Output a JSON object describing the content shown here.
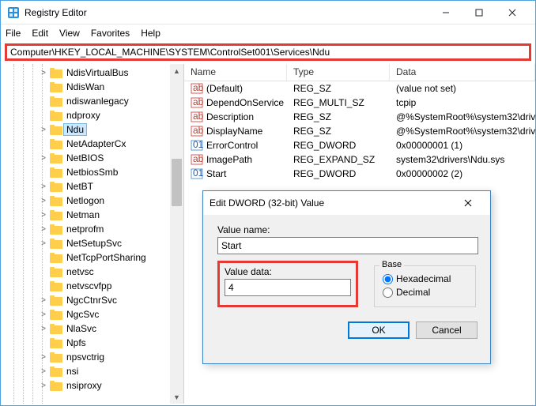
{
  "window": {
    "title": "Registry Editor"
  },
  "menu": {
    "file": "File",
    "edit": "Edit",
    "view": "View",
    "favorites": "Favorites",
    "help": "Help"
  },
  "address": {
    "value": "Computer\\HKEY_LOCAL_MACHINE\\SYSTEM\\ControlSet001\\Services\\Ndu"
  },
  "tree": {
    "items": [
      {
        "label": "NdisVirtualBus",
        "tw": ">"
      },
      {
        "label": "NdisWan",
        "tw": ""
      },
      {
        "label": "ndiswanlegacy",
        "tw": ""
      },
      {
        "label": "ndproxy",
        "tw": ""
      },
      {
        "label": "Ndu",
        "tw": ">",
        "selected": true
      },
      {
        "label": "NetAdapterCx",
        "tw": ""
      },
      {
        "label": "NetBIOS",
        "tw": ">"
      },
      {
        "label": "NetbiosSmb",
        "tw": ""
      },
      {
        "label": "NetBT",
        "tw": ">"
      },
      {
        "label": "Netlogon",
        "tw": ">"
      },
      {
        "label": "Netman",
        "tw": ">"
      },
      {
        "label": "netprofm",
        "tw": ">"
      },
      {
        "label": "NetSetupSvc",
        "tw": ">"
      },
      {
        "label": "NetTcpPortSharing",
        "tw": ""
      },
      {
        "label": "netvsc",
        "tw": ""
      },
      {
        "label": "netvscvfpp",
        "tw": ""
      },
      {
        "label": "NgcCtnrSvc",
        "tw": ">"
      },
      {
        "label": "NgcSvc",
        "tw": ">"
      },
      {
        "label": "NlaSvc",
        "tw": ">"
      },
      {
        "label": "Npfs",
        "tw": ""
      },
      {
        "label": "npsvctrig",
        "tw": ">"
      },
      {
        "label": "nsi",
        "tw": ">"
      },
      {
        "label": "nsiproxy",
        "tw": ">"
      }
    ]
  },
  "list": {
    "headers": {
      "name": "Name",
      "type": "Type",
      "data": "Data"
    },
    "rows": [
      {
        "icon": "str",
        "name": "(Default)",
        "type": "REG_SZ",
        "data": "(value not set)"
      },
      {
        "icon": "str",
        "name": "DependOnService",
        "type": "REG_MULTI_SZ",
        "data": "tcpip"
      },
      {
        "icon": "str",
        "name": "Description",
        "type": "REG_SZ",
        "data": "@%SystemRoot%\\system32\\driv"
      },
      {
        "icon": "str",
        "name": "DisplayName",
        "type": "REG_SZ",
        "data": "@%SystemRoot%\\system32\\driv"
      },
      {
        "icon": "bin",
        "name": "ErrorControl",
        "type": "REG_DWORD",
        "data": "0x00000001 (1)"
      },
      {
        "icon": "str",
        "name": "ImagePath",
        "type": "REG_EXPAND_SZ",
        "data": "system32\\drivers\\Ndu.sys"
      },
      {
        "icon": "bin",
        "name": "Start",
        "type": "REG_DWORD",
        "data": "0x00000002 (2)"
      }
    ]
  },
  "dialog": {
    "title": "Edit DWORD (32-bit) Value",
    "value_name_label": "Value name:",
    "value_name": "Start",
    "value_data_label": "Value data:",
    "value_data": "4",
    "base_label": "Base",
    "hex_label": "Hexadecimal",
    "dec_label": "Decimal",
    "ok": "OK",
    "cancel": "Cancel"
  }
}
